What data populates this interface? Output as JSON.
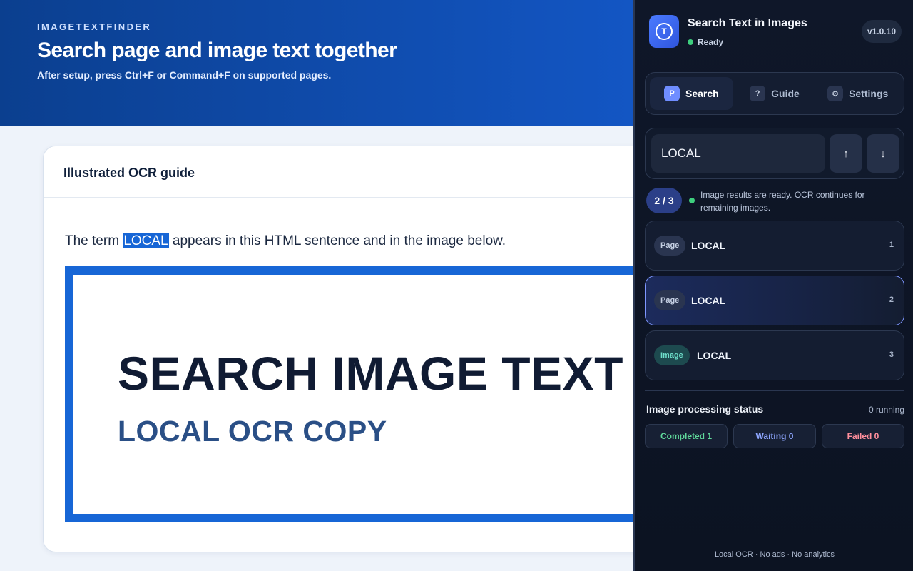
{
  "page": {
    "brand": "IMAGETEXTFINDER",
    "title": "Search page and image text together",
    "subtitle": "After setup, press Ctrl+F or Command+F on supported pages.",
    "card_title": "Illustrated OCR guide",
    "sentence_before": "The term ",
    "sentence_highlight": "LOCAL",
    "sentence_after": " appears in this HTML sentence and in the image below.",
    "image_line1": "SEARCH IMAGE TEXT",
    "image_line2": "LOCAL OCR COPY"
  },
  "panel": {
    "app_icon_letter": "T",
    "app_title": "Search Text in Images",
    "status": "Ready",
    "version": "v1.0.10",
    "tabs": [
      {
        "label": "Search",
        "icon": "P"
      },
      {
        "label": "Guide",
        "icon": "?"
      },
      {
        "label": "Settings",
        "icon": "⚙"
      }
    ],
    "search_value": "LOCAL",
    "prev_glyph": "↑",
    "next_glyph": "↓",
    "match_count": "2 / 3",
    "status_message": "Image results are ready. OCR continues for remaining images.",
    "results": [
      {
        "badge": "Page",
        "text": "LOCAL",
        "index": "1"
      },
      {
        "badge": "Page",
        "text": "LOCAL",
        "index": "2"
      },
      {
        "badge": "Image",
        "text": "LOCAL",
        "index": "3"
      }
    ],
    "processing_title": "Image processing status",
    "running": "0 running",
    "completed": "Completed 1",
    "waiting": "Waiting 0",
    "failed": "Failed 0",
    "footer": "Local OCR · No ads · No analytics"
  },
  "colors": {
    "accent": "#1766d6",
    "panel_bg": "#0f1729",
    "success": "#3ecf7e",
    "active_border": "#7f97ff"
  }
}
